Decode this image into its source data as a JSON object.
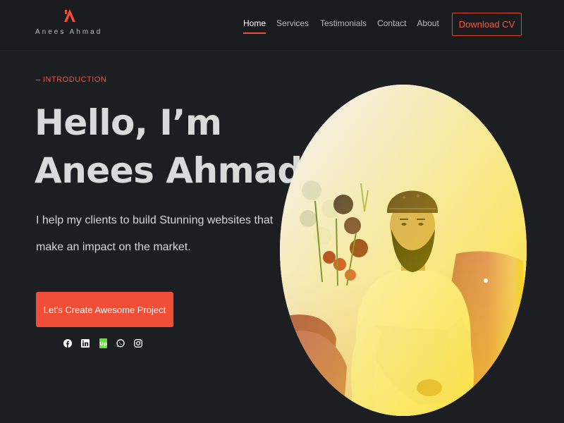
{
  "header": {
    "logo_mark": "A",
    "logo_text": "Anees Ahmad",
    "nav": [
      {
        "label": "Home",
        "active": true
      },
      {
        "label": "Services",
        "active": false
      },
      {
        "label": "Testimonials",
        "active": false
      },
      {
        "label": "Contact",
        "active": false
      },
      {
        "label": "About",
        "active": false
      }
    ],
    "cv_button": "Download CV"
  },
  "hero": {
    "eyebrow": "INTRODUCTION",
    "title_line1": "Hello, I’m",
    "title_line2": "Anees Ahmad",
    "description": "I help my clients to build Stunning websites that make an impact on the market.",
    "cta": "Let's Create Awesome Project"
  },
  "socials": [
    {
      "icon": "facebook-icon"
    },
    {
      "icon": "linkedin-icon"
    },
    {
      "icon": "upwork-icon"
    },
    {
      "icon": "whatsapp-icon"
    },
    {
      "icon": "instagram-icon"
    }
  ],
  "colors": {
    "accent": "#f04e36",
    "background": "#1d1e22",
    "header_bg": "#1a1b1f",
    "upwork": "#6fda44"
  }
}
